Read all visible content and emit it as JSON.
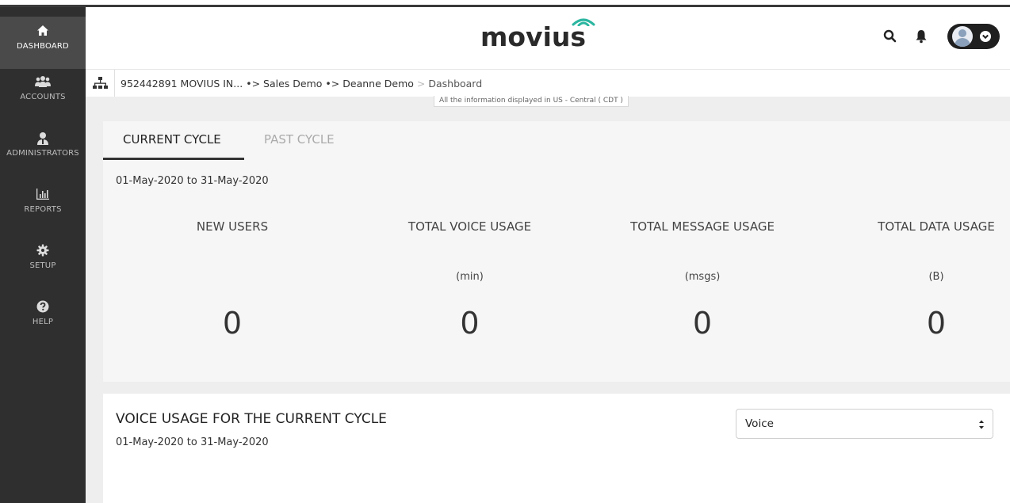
{
  "sidebar": {
    "items": [
      {
        "label": "DASHBOARD",
        "icon": "home-icon",
        "active": true
      },
      {
        "label": "ACCOUNTS",
        "icon": "users-icon",
        "active": false
      },
      {
        "label": "ADMINISTRATORS",
        "icon": "admin-icon",
        "active": false
      },
      {
        "label": "REPORTS",
        "icon": "bar-chart-icon",
        "active": false
      },
      {
        "label": "SETUP",
        "icon": "gear-icon",
        "active": false
      },
      {
        "label": "HELP",
        "icon": "question-icon",
        "active": false
      }
    ]
  },
  "header": {
    "logo_text": "movius",
    "icons": [
      "search-icon",
      "bell-icon",
      "avatar",
      "chevron-down-icon"
    ]
  },
  "breadcrumb": {
    "items": [
      "952442891 MOVIUS IN...",
      "Sales Demo",
      "Deanne Demo",
      "Dashboard"
    ],
    "separator": "•>",
    "light_separator": ">",
    "timezone_note": "All the information displayed in US - Central ( CDT )"
  },
  "cycle": {
    "tabs": [
      {
        "label": "CURRENT CYCLE",
        "active": true
      },
      {
        "label": "PAST CYCLE",
        "active": false
      }
    ],
    "range": "01-May-2020 to 31-May-2020",
    "stats": [
      {
        "title": "NEW USERS",
        "unit": "",
        "value": "0"
      },
      {
        "title": "TOTAL VOICE USAGE",
        "unit": "(min)",
        "value": "0"
      },
      {
        "title": "TOTAL MESSAGE USAGE",
        "unit": "(msgs)",
        "value": "0"
      },
      {
        "title": "TOTAL DATA USAGE",
        "unit": "(B)",
        "value": "0"
      }
    ]
  },
  "usage": {
    "title": "VOICE USAGE FOR THE CURRENT CYCLE",
    "range": "01-May-2020 to 31-May-2020",
    "select_value": "Voice"
  },
  "colors": {
    "sidebar_bg": "#2f2f2f",
    "sidebar_active": "#4a4a4a",
    "content_bg": "#eeeeee",
    "logo_accent": "#2bb6a0"
  }
}
